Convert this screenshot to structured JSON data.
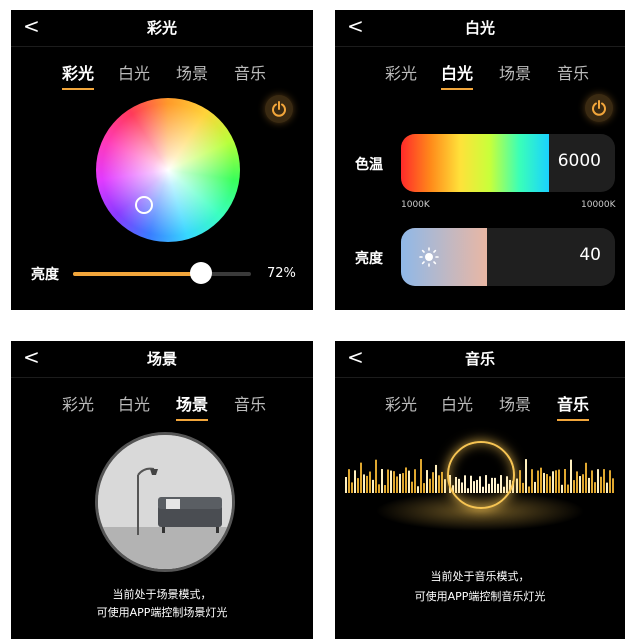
{
  "tabs": [
    "彩光",
    "白光",
    "场景",
    "音乐"
  ],
  "back_glyph": "<",
  "colors": {
    "accent": "#f2a63b",
    "background": "#000000",
    "panel_bar": "#1f1f1f"
  },
  "panel_color": {
    "title": "彩光",
    "active_tab": "彩光",
    "brightness_label": "亮度",
    "brightness_value": "72%",
    "brightness_fraction": 0.72
  },
  "panel_white": {
    "title": "白光",
    "active_tab": "白光",
    "color_temp_label": "色温",
    "color_temp_value": "6000",
    "color_temp_min": "1000K",
    "color_temp_max": "10000K",
    "brightness_label": "亮度",
    "brightness_value": "40",
    "brightness_fraction": 0.4
  },
  "panel_scene": {
    "title": "场景",
    "active_tab": "场景",
    "caption_line1": "当前处于场景模式，",
    "caption_line2": "可使用APP端控制场景灯光"
  },
  "panel_music": {
    "title": "音乐",
    "active_tab": "音乐",
    "caption_line1": "当前处于音乐模式，",
    "caption_line2": "可使用APP端控制音乐灯光"
  },
  "icons": [
    "back-icon",
    "power-icon",
    "sun-icon",
    "color-wheel",
    "scene-photo",
    "music-visualizer"
  ]
}
